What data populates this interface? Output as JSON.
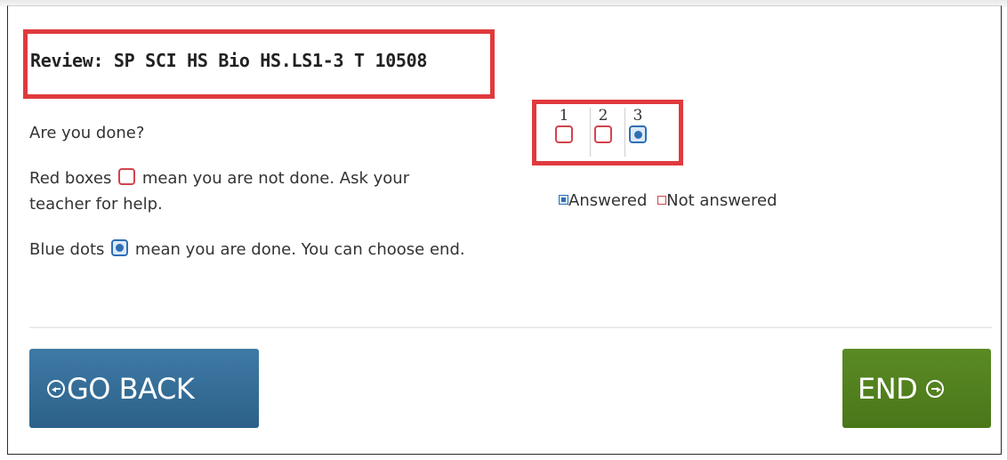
{
  "review": {
    "title": "Review: SP SCI HS Bio HS.LS1-3 T 10508"
  },
  "instructions": {
    "question": "Are you done?",
    "red_before": "Red boxes",
    "red_after": "mean you are not done. Ask your teacher for help.",
    "blue_before": "Blue dots",
    "blue_after": "mean you are done. You can choose end."
  },
  "questions": [
    {
      "number": "1",
      "status": "not_answered"
    },
    {
      "number": "2",
      "status": "not_answered"
    },
    {
      "number": "3",
      "status": "answered"
    }
  ],
  "legend": {
    "answered": "Answered",
    "not_answered": "Not answered"
  },
  "buttons": {
    "go_back": "GO BACK",
    "end": "END"
  },
  "icons": {
    "go_back": "arrow-left-circle-icon",
    "end": "arrow-right-circle-icon"
  },
  "colors": {
    "not_answered": "#d3434d",
    "answered": "#2f6fb4",
    "go_back_button": "#33698f",
    "end_button": "#527f1f",
    "highlight": "#e03a3e"
  }
}
